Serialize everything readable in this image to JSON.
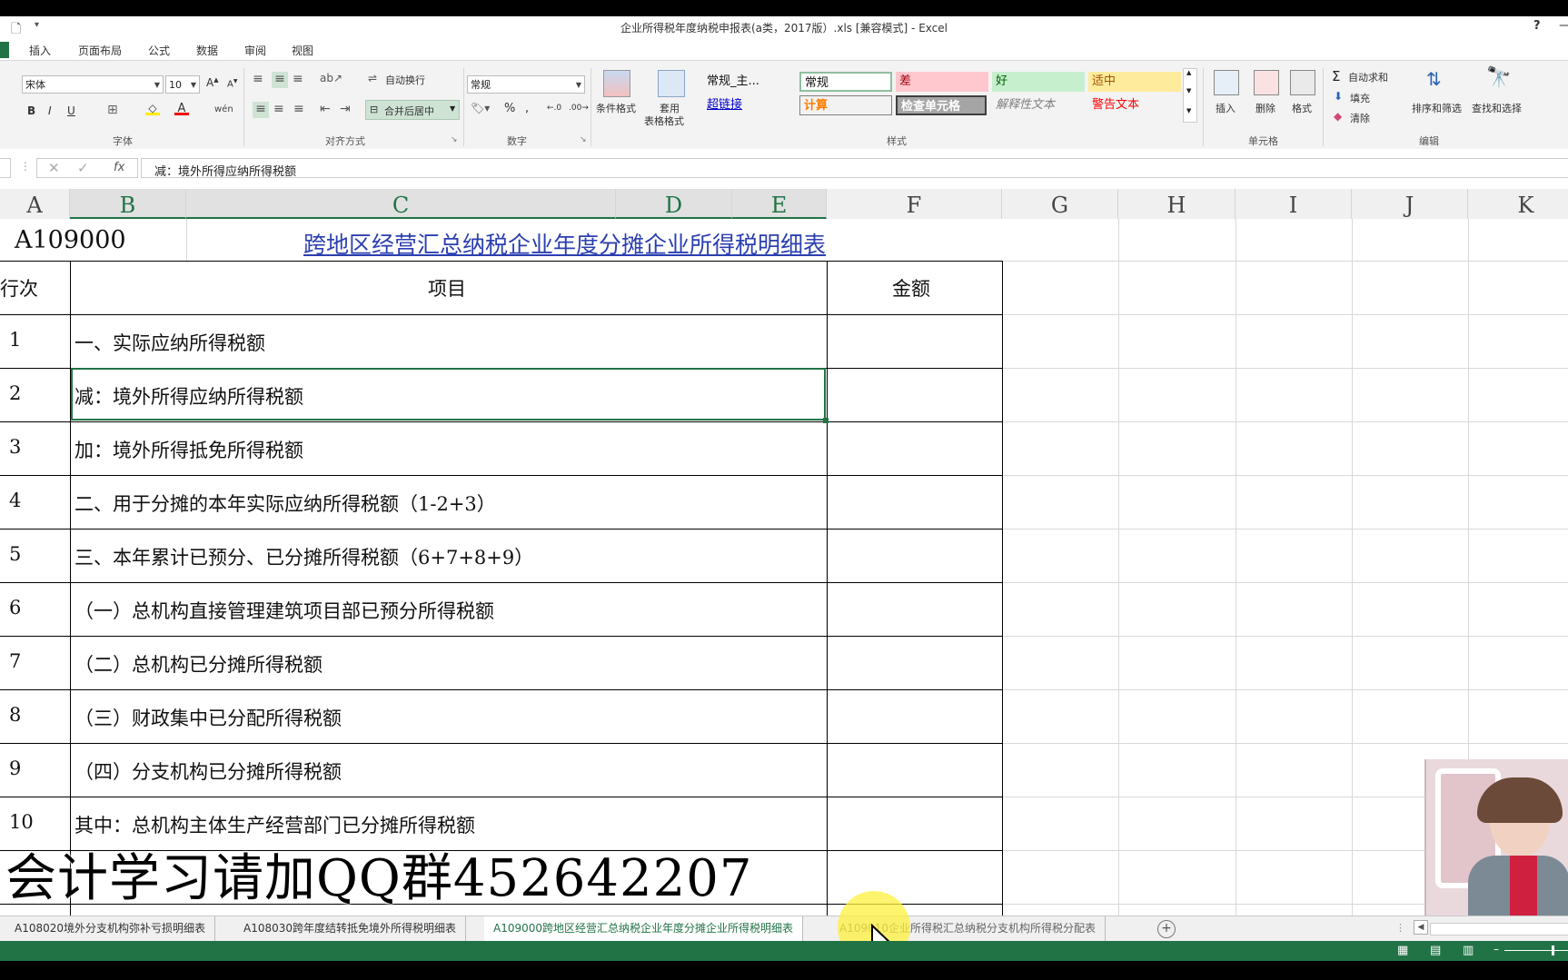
{
  "window": {
    "title": "企业所得税年度纳税申报表(a类，2017版）.xls  [兼容模式] - Excel",
    "help": "?"
  },
  "ribbon_tabs": [
    "插入",
    "页面布局",
    "公式",
    "数据",
    "审阅",
    "视图"
  ],
  "ribbon": {
    "font_name": "宋体",
    "font_size": "10",
    "wrap_text": "自动换行",
    "merge_center": "合并后居中",
    "number_format": "常规",
    "cond_format": "条件格式",
    "table_format_1": "套用",
    "table_format_2": "表格格式",
    "styles": {
      "s1": "常规_主...",
      "s2": "常规",
      "s3": "差",
      "s4": "好",
      "s5": "适中",
      "s6": "超链接",
      "s7": "计算",
      "s8": "检查单元格",
      "s9": "解释性文本",
      "s10": "警告文本"
    },
    "insert": "插入",
    "delete": "删除",
    "format": "格式",
    "autosum": "自动求和",
    "fill": "填充",
    "clear": "清除",
    "sort": "排序和筛选",
    "find": "查找和选择",
    "groups": {
      "font": "字体",
      "align": "对齐方式",
      "number": "数字",
      "styles": "样式",
      "cells": "单元格",
      "edit": "编辑"
    }
  },
  "formula_bar": {
    "fx": "fx",
    "content": "减：境外所得应纳所得税额"
  },
  "columns": [
    "A",
    "B",
    "C",
    "D",
    "E",
    "F",
    "G",
    "H",
    "I",
    "J",
    "K"
  ],
  "sheet": {
    "code": "A109000",
    "title": "跨地区经营汇总纳税企业年度分摊企业所得税明细表",
    "header_row": "行次",
    "header_item": "项目",
    "header_amount": "金额",
    "rows": [
      {
        "no": "1",
        "item": "一、实际应纳所得税额"
      },
      {
        "no": "2",
        "item": "减：境外所得应纳所得税额"
      },
      {
        "no": "3",
        "item": "加：境外所得抵免所得税额"
      },
      {
        "no": "4",
        "item": "二、用于分摊的本年实际应纳所得税额（1-2+3）"
      },
      {
        "no": "5",
        "item": "三、本年累计已预分、已分摊所得税额（6+7+8+9）"
      },
      {
        "no": "6",
        "item": "（一）总机构直接管理建筑项目部已预分所得税额"
      },
      {
        "no": "7",
        "item": "（二）总机构已分摊所得税额"
      },
      {
        "no": "8",
        "item": "（三）财政集中已分配所得税额"
      },
      {
        "no": "9",
        "item": "（四）分支机构已分摊所得税额"
      },
      {
        "no": "10",
        "item": "其中：总机构主体生产经营部门已分摊所得税额"
      }
    ]
  },
  "watermark": "会计学习请加QQ群452642207",
  "sheet_tabs": [
    "A108020境外分支机构弥补亏损明细表",
    "A108030跨年度结转抵免境外所得税明细表",
    "A109000跨地区经营汇总纳税企业年度分摊企业所得税明细表",
    "A109010企业所得税汇总纳税分支机构所得税分配表"
  ],
  "active_sheet_index": 2
}
